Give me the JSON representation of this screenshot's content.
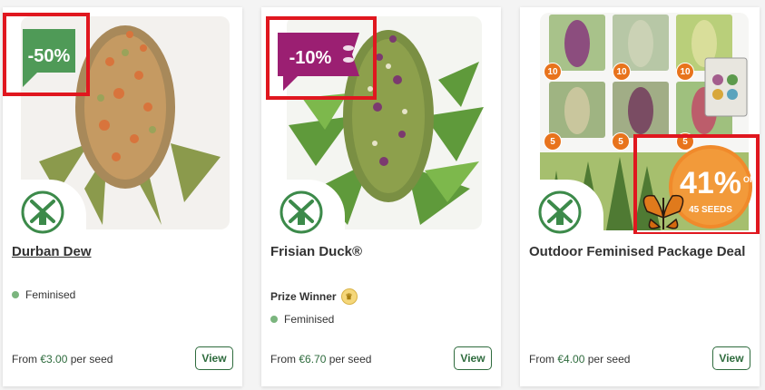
{
  "products": [
    {
      "name": "Durban Dew",
      "discount": "-50%",
      "feature": "Feminised",
      "price_prefix": "From",
      "price": "€3.00",
      "price_suffix": "per seed",
      "button": "View"
    },
    {
      "name": "Frisian Duck®",
      "discount": "-10%",
      "prize": "Prize Winner",
      "feature": "Feminised",
      "price_prefix": "From",
      "price": "€6.70",
      "price_suffix": "per seed",
      "button": "View"
    },
    {
      "name": "Outdoor Feminised Package Deal",
      "discount_pct": "41%",
      "discount_off": "OFF",
      "discount_seeds": "45 SEEDS",
      "package_counts": [
        "10",
        "10",
        "10",
        "5",
        "5",
        "5"
      ],
      "price_prefix": "From",
      "price": "€4.00",
      "price_suffix": "per seed",
      "button": "View"
    }
  ],
  "colors": {
    "brand_green": "#2e6b3d",
    "feature_dot": "#7bb57e",
    "badge_green": "#4f9a57",
    "badge_purple": "#9b1f72",
    "badge_orange": "#e8731c",
    "highlight_red": "#e0171f"
  },
  "icons": {
    "logo": "windmill-icon",
    "prize": "crown-icon",
    "promo": "butterfly-icon"
  }
}
